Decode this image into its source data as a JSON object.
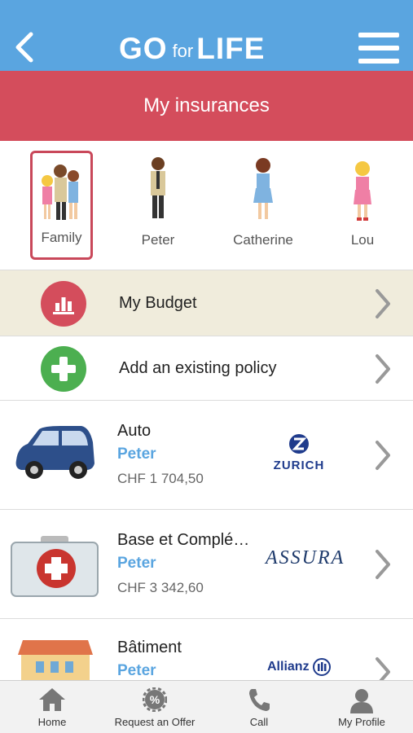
{
  "header": {
    "logo_go": "GO",
    "logo_for": "for",
    "logo_life": "LIFE",
    "back_icon": "chevron-left-icon",
    "menu_icon": "hamburger-menu-icon"
  },
  "title": "My insurances",
  "members": [
    {
      "label": "Family",
      "selected": true
    },
    {
      "label": "Peter"
    },
    {
      "label": "Catherine"
    },
    {
      "label": "Lou"
    }
  ],
  "actions": {
    "budget_label": "My Budget",
    "add_policy_label": "Add an existing policy"
  },
  "policies": [
    {
      "title": "Auto",
      "person": "Peter",
      "price": "CHF 1 704,50",
      "insurer": "ZURICH"
    },
    {
      "title": "Base et Complé…",
      "person": "Peter",
      "price": "CHF 3 342,60",
      "insurer": "ASSURA"
    },
    {
      "title": "Bâtiment",
      "person": "Peter",
      "price": "",
      "insurer": "Allianz"
    }
  ],
  "tabs": [
    {
      "label": "Home",
      "icon": "home-icon"
    },
    {
      "label": "Request an Offer",
      "icon": "percent-gear-icon"
    },
    {
      "label": "Call",
      "icon": "phone-icon"
    },
    {
      "label": "My Profile",
      "icon": "person-icon"
    }
  ],
  "colors": {
    "header_blue": "#5aa5e0",
    "title_red": "#d44d5c",
    "budget_bg": "#f0ecdc",
    "accent_green": "#4caf50"
  }
}
